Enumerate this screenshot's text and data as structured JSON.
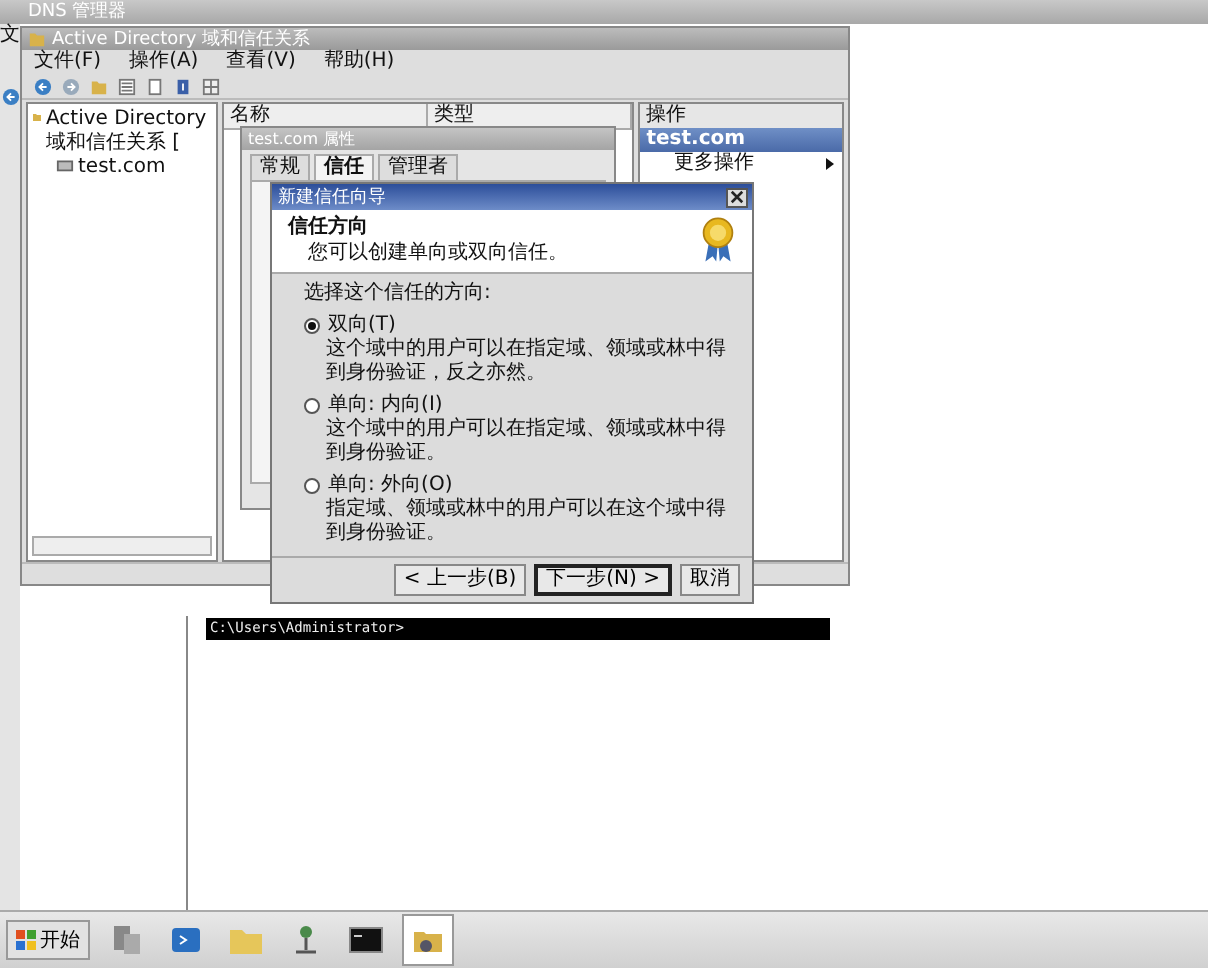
{
  "dns_window": {
    "title": "DNS 管理器",
    "menu_fragment": "文"
  },
  "ad_window": {
    "title": "Active Directory 域和信任关系",
    "menu": [
      "文件(F)",
      "操作(A)",
      "查看(V)",
      "帮助(H)"
    ],
    "tree": [
      {
        "label": "Active Directory 域和信任关系 [",
        "children": [
          {
            "label": "test.com"
          }
        ]
      }
    ],
    "columns": [
      "名称",
      "类型"
    ],
    "actions": {
      "title": "操作",
      "section": "test.com",
      "items": [
        "更多操作"
      ]
    }
  },
  "properties_dialog": {
    "title": "test.com 属性",
    "tabs": [
      {
        "label": "常规",
        "selected": false
      },
      {
        "label": "信任",
        "selected": true
      },
      {
        "label": "管理者",
        "selected": false
      }
    ]
  },
  "wizard": {
    "title": "新建信任向导",
    "heading": "信任方向",
    "subheading": "您可以创建单向或双向信任。",
    "prompt": "选择这个信任的方向:",
    "options": [
      {
        "label": "双向(T)",
        "description": "这个域中的用户可以在指定域、领域或林中得到身份验证，反之亦然。",
        "selected": true
      },
      {
        "label": "单向: 内向(I)",
        "description": "这个域中的用户可以在指定域、领域或林中得到身份验证。",
        "selected": false
      },
      {
        "label": "单向: 外向(O)",
        "description": "指定域、领域或林中的用户可以在这个域中得到身份验证。",
        "selected": false
      }
    ],
    "buttons": [
      {
        "label": "< 上一步(B)",
        "default": false
      },
      {
        "label": "下一步(N) >",
        "default": true
      },
      {
        "label": "取消",
        "default": false
      }
    ]
  },
  "console": {
    "prompt": "C:\\Users\\Administrator>"
  },
  "taskbar": {
    "start": "开始"
  }
}
